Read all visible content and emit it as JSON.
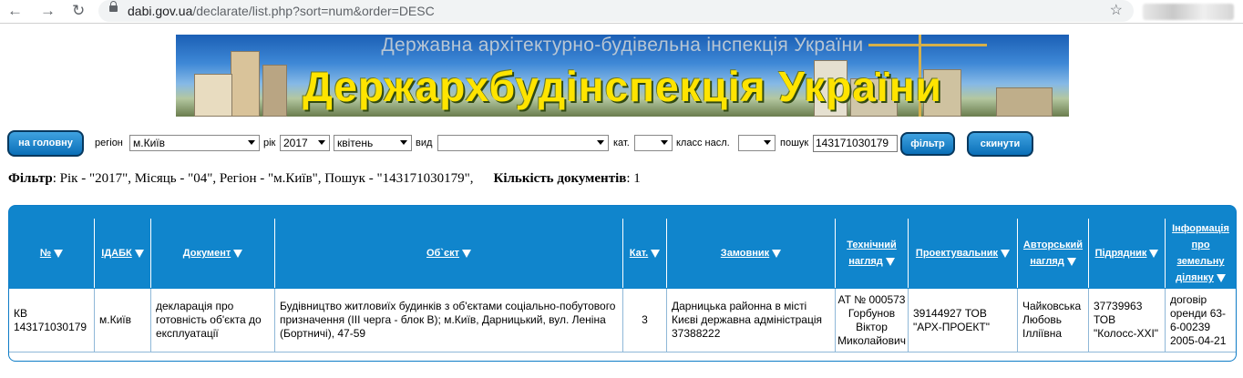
{
  "browser": {
    "url_host": "dabi.gov.ua",
    "url_path": "/declarate/list.php?sort=num&order=DESC"
  },
  "banner": {
    "line1": "Державна архітектурно-будівельна інспекція України",
    "line2": "Держархбудінспекція України"
  },
  "toolbar": {
    "home_label": "на головну",
    "region_label": "регіон",
    "region_value": "м.Київ",
    "year_label": "рік",
    "year_value": "2017",
    "month_value": "квітень",
    "type_label": "вид",
    "type_value": "",
    "cat_label": "кат.",
    "cat_value": "",
    "class_label": "класс насл.",
    "class_value": "",
    "search_label": "пошук",
    "search_value": "143171030179",
    "filter_label": "фільтр",
    "reset_label": "скинути"
  },
  "filter_summary": {
    "filter_key": "Фільтр",
    "filter_text": ": Рік - \"2017\", Місяць - \"04\", Регіон - \"м.Київ\", Пошук - \"143171030179\",",
    "count_key": "Кількість документів",
    "count_text": ": 1"
  },
  "table": {
    "headers": [
      {
        "l1": "№",
        "l2": ""
      },
      {
        "l1": "ІДАБК",
        "l2": ""
      },
      {
        "l1": "Документ",
        "l2": ""
      },
      {
        "l1": "Об`єкт",
        "l2": ""
      },
      {
        "l1": "Кат.",
        "l2": ""
      },
      {
        "l1": "Замовник",
        "l2": ""
      },
      {
        "l1": "Технічний",
        "l2": "нагляд"
      },
      {
        "l1": "Проектувальник",
        "l2": ""
      },
      {
        "l1": "Авторський",
        "l2": "нагляд"
      },
      {
        "l1": "Підрядник",
        "l2": ""
      },
      {
        "l1": "Інформація про земельну",
        "l2": "ділянку"
      }
    ],
    "rows": [
      {
        "num": "КВ 143171030179",
        "idabk": "м.Київ",
        "document": "декларація про готовність об'єкта до експлуатації",
        "object": "Будівництво житловиїх будинків з об'єктами соціально-побутового призначення (ІІІ черга - блок В); м.Київ, Дарницький, вул. Леніна (Бортничі), 47-59",
        "cat": "3",
        "customer": "Дарницька районна в місті Києві державна адміністрація 37388222",
        "tech": "АТ № 000573 Горбунов Віктор Миколайович",
        "designer": "39144927 ТОВ \"АРХ-ПРОЕКТ\"",
        "author": "Чайковська Любовь Ілліївна",
        "contractor": "37739963 ТОВ \"Колосс-ХХІ\"",
        "land": "договір оренди 63-6-00239 2005-04-21"
      }
    ]
  }
}
